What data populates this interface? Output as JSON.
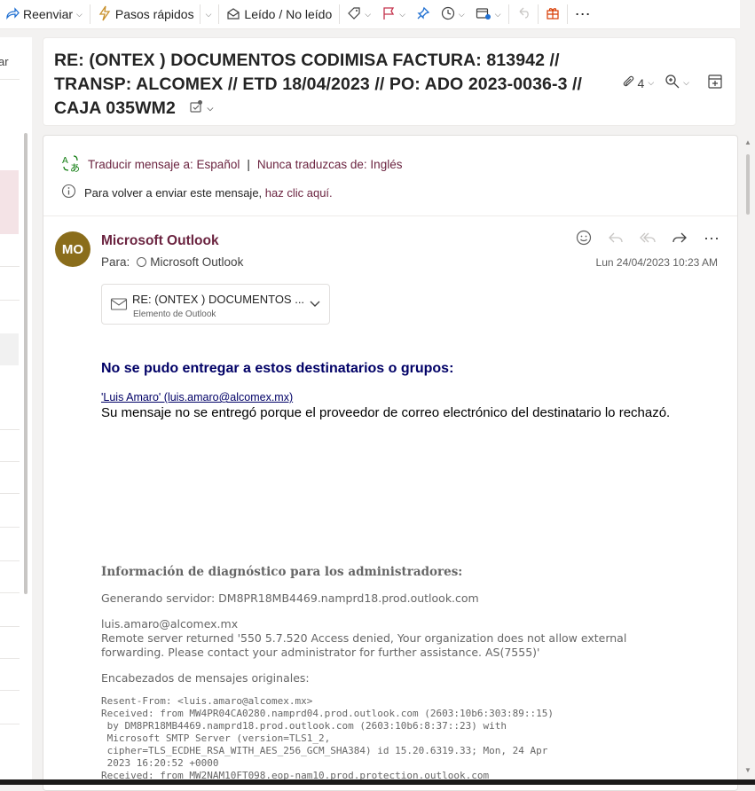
{
  "toolbar": {
    "forward_label": "Reenviar",
    "quick_steps_label": "Pasos rápidos",
    "read_unread_label": "Leído / No leído"
  },
  "left_pane": {
    "cut_text": "ar"
  },
  "header": {
    "subject": "RE: (ONTEX ) DOCUMENTOS CODIMISA FACTURA: 813942 // TRANSP: ALCOMEX // ETD 18/04/2023 // PO: ADO 2023-0036-3 // CAJA 035WM2",
    "attachment_count": "4"
  },
  "translate": {
    "translate_link": "Traducir mensaje a: Español",
    "separator": "|",
    "never_link": "Nunca traduzcas de: Inglés"
  },
  "resend": {
    "text": "Para volver a enviar este mensaje,",
    "link": "haz clic aquí."
  },
  "message": {
    "avatar_initials": "MO",
    "sender": "Microsoft Outlook",
    "to_label": "Para:",
    "to_name": "Microsoft Outlook",
    "date": "Lun 24/04/2023 10:23 AM",
    "attachment_name": "RE: (ONTEX ) DOCUMENTOS ...",
    "attachment_type": "Elemento de Outlook"
  },
  "body": {
    "ndr_title": "No se pudo entregar a estos destinatarios o grupos:",
    "recipient_link": "'Luis Amaro' (luis.amaro@alcomex.mx)",
    "ndr_message": "Su mensaje no se entregó porque el proveedor de correo electrónico del destinatario lo rechazó.",
    "diag_title": "Información de diagnóstico para los administradores:",
    "generating_server": "Generando servidor: DM8PR18MB4469.namprd18.prod.outlook.com",
    "recipient_email": "luis.amaro@alcomex.mx",
    "remote_error": "Remote server returned '550 5.7.520 Access denied, Your organization does not allow external forwarding. Please contact your administrator for further assistance. AS(7555)'",
    "headers_title": "Encabezados de mensajes originales:",
    "raw_headers": "Resent-From: <luis.amaro@alcomex.mx>\nReceived: from MW4PR04CA0280.namprd04.prod.outlook.com (2603:10b6:303:89::15)\n by DM8PR18MB4469.namprd18.prod.outlook.com (2603:10b6:8:37::23) with\n Microsoft SMTP Server (version=TLS1_2,\n cipher=TLS_ECDHE_RSA_WITH_AES_256_GCM_SHA384) id 15.20.6319.33; Mon, 24 Apr\n 2023 16:20:52 +0000\nReceived: from MW2NAM10FT098.eop-nam10.prod.protection.outlook.com"
  },
  "colors": {
    "accent": "#6b2440",
    "avatar": "#8a6d1b",
    "ndr_blue": "#000066",
    "diag_grey": "#666666"
  },
  "icons": [
    "forward-icon",
    "lightning-icon",
    "envelope-open-icon",
    "tag-icon",
    "flag-icon",
    "pin-icon",
    "clock-icon",
    "move-icon",
    "undo-icon",
    "apps-icon",
    "more-icon",
    "paperclip-icon",
    "zoom-icon",
    "popout-icon",
    "translate-icon",
    "info-icon",
    "emoji-icon",
    "reply-icon",
    "reply-all-icon",
    "forward-arrow-icon",
    "mail-icon"
  ]
}
